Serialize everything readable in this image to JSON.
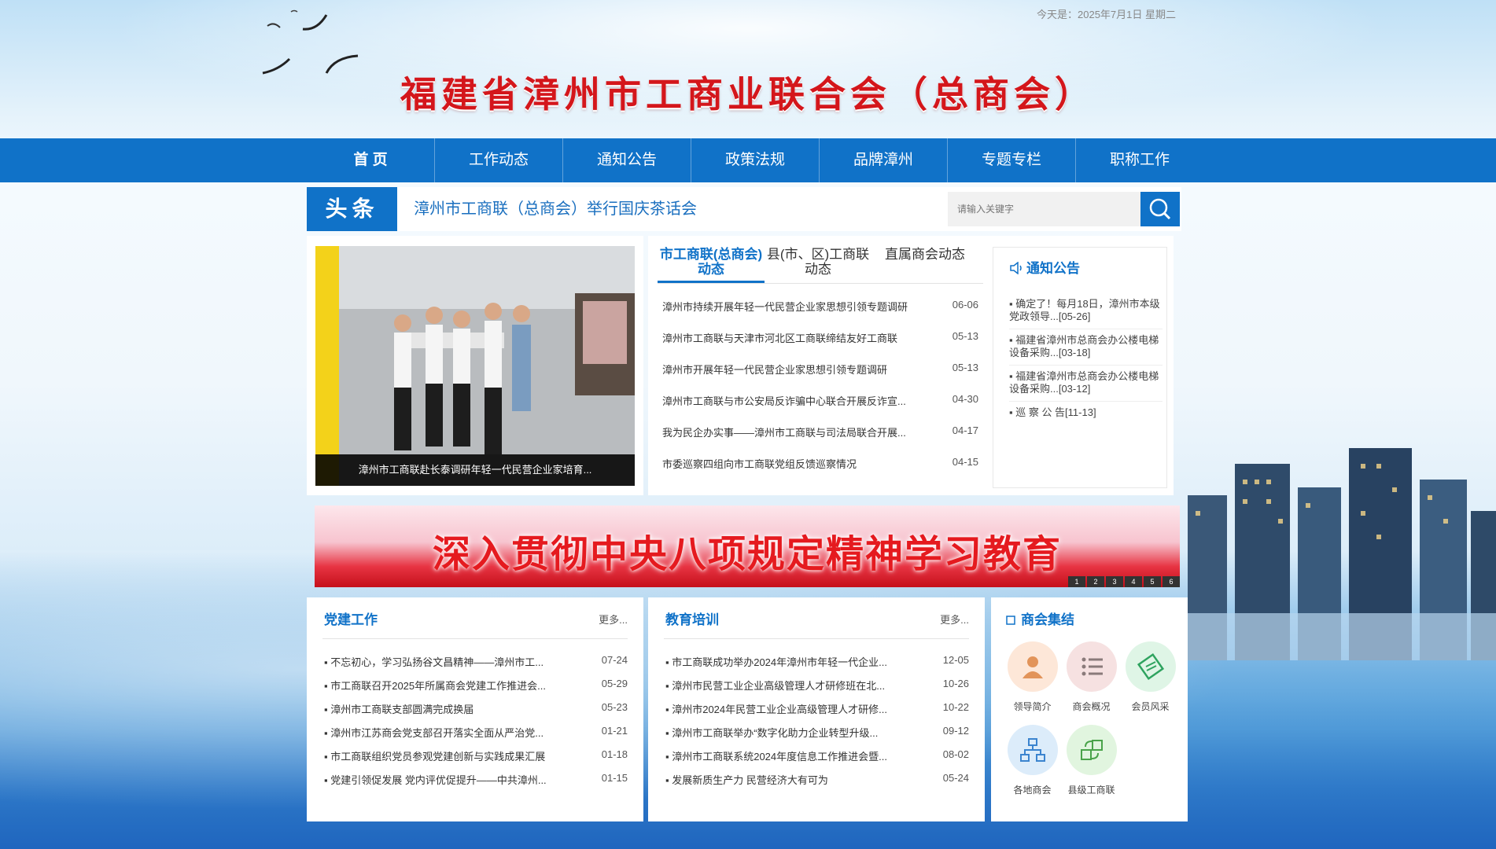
{
  "header": {
    "date": "今天是：2025年7月1日 星期二",
    "title": "福建省漳州市工商业联合会（总商会）"
  },
  "nav": {
    "items": [
      {
        "label": "首 页"
      },
      {
        "label": "工作动态"
      },
      {
        "label": "通知公告"
      },
      {
        "label": "政策法规"
      },
      {
        "label": "品牌漳州"
      },
      {
        "label": "专题专栏"
      },
      {
        "label": "职称工作"
      }
    ]
  },
  "headline": {
    "badge": "头条",
    "text": "漳州市工商联（总商会）举行国庆茶话会"
  },
  "search": {
    "placeholder": "请输入关键字"
  },
  "photo": {
    "caption": "漳州市工商联赴长泰调研年轻一代民营企业家培育..."
  },
  "news": {
    "tabs": [
      "市工商联(总商会)动态",
      "县(市、区)工商联动态",
      "直属商会动态"
    ],
    "items": [
      {
        "title": "漳州市持续开展年轻一代民营企业家思想引领专题调研",
        "date": "06-06"
      },
      {
        "title": "漳州市工商联与天津市河北区工商联缔结友好工商联",
        "date": "05-13"
      },
      {
        "title": "漳州市开展年轻一代民营企业家思想引领专题调研",
        "date": "05-13"
      },
      {
        "title": "漳州市工商联与市公安局反诈骗中心联合开展反诈宣...",
        "date": "04-30"
      },
      {
        "title": "我为民企办实事——漳州市工商联与司法局联合开展...",
        "date": "04-17"
      },
      {
        "title": "市委巡察四组向市工商联党组反馈巡察情况",
        "date": "04-15"
      }
    ]
  },
  "notice": {
    "title": "通知公告",
    "items": [
      "▪ 确定了！每月18日，漳州市本级党政领导...[05-26]",
      "▪ 福建省漳州市总商会办公楼电梯设备采购...[03-18]",
      "▪ 福建省漳州市总商会办公楼电梯设备采购...[03-12]",
      "▪ 巡 察 公 告[11-13]"
    ]
  },
  "banner": {
    "text": "深入贯彻中央八项规定精神学习教育",
    "pages": [
      "1",
      "2",
      "3",
      "4",
      "5",
      "6"
    ]
  },
  "party": {
    "title": "党建工作",
    "more": "更多...",
    "items": [
      {
        "title": "▪ 不忘初心，学习弘扬谷文昌精神——漳州市工...",
        "date": "07-24"
      },
      {
        "title": "▪ 市工商联召开2025年所属商会党建工作推进会...",
        "date": "05-29"
      },
      {
        "title": "▪ 漳州市工商联支部圆满完成换届",
        "date": "05-23"
      },
      {
        "title": "▪ 漳州市江苏商会党支部召开落实全面从严治党...",
        "date": "01-21"
      },
      {
        "title": "▪ 市工商联组织党员参观党建创新与实践成果汇展",
        "date": "01-18"
      },
      {
        "title": "▪ 党建引领促发展 党内评优促提升——中共漳州...",
        "date": "01-15"
      }
    ]
  },
  "education": {
    "title": "教育培训",
    "more": "更多...",
    "items": [
      {
        "title": "▪ 市工商联成功举办2024年漳州市年轻一代企业...",
        "date": "12-05"
      },
      {
        "title": "▪ 漳州市民营工业企业高级管理人才研修班在北...",
        "date": "10-26"
      },
      {
        "title": "▪ 漳州市2024年民营工业企业高级管理人才研修...",
        "date": "10-22"
      },
      {
        "title": "▪ 漳州市工商联举办“数字化助力企业转型升级...",
        "date": "09-12"
      },
      {
        "title": "▪ 漳州市工商联系统2024年度信息工作推进会暨...",
        "date": "08-02"
      },
      {
        "title": "▪ 发展新质生产力 民营经济大有可为",
        "date": "05-24"
      }
    ]
  },
  "chamber": {
    "title": "商会集结",
    "items": [
      {
        "label": "领导简介",
        "color": "#fde7d8"
      },
      {
        "label": "商会概况",
        "color": "#f6e1e1"
      },
      {
        "label": "会员风采",
        "color": "#dff5e6"
      },
      {
        "label": "各地商会",
        "color": "#dcecfa"
      },
      {
        "label": "县级工商联",
        "color": "#e1f5df"
      }
    ]
  }
}
